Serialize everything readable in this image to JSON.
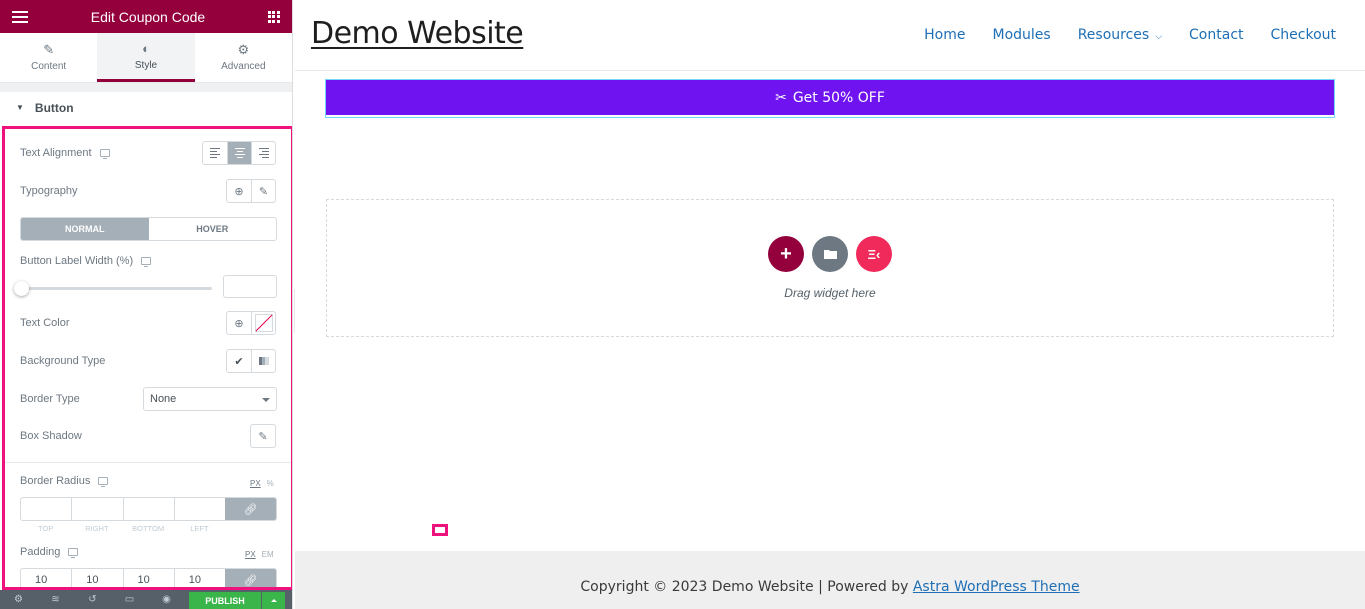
{
  "editor": {
    "title": "Edit Coupon Code",
    "menu_icon": "hamburger-icon",
    "apps_icon": "grid-icon",
    "tabs": [
      {
        "label": "Content",
        "icon": "pencil-icon",
        "active": false
      },
      {
        "label": "Style",
        "icon": "contrast-icon",
        "active": true
      },
      {
        "label": "Advanced",
        "icon": "gear-icon",
        "active": false
      }
    ],
    "section": "Button",
    "controls": {
      "text_alignment": {
        "label": "Text Alignment",
        "options": [
          "left",
          "center",
          "right"
        ],
        "selected": "center"
      },
      "typography": {
        "label": "Typography"
      },
      "state_tabs": {
        "normal": "NORMAL",
        "hover": "HOVER",
        "selected": "NORMAL"
      },
      "label_width": {
        "label": "Button Label Width (%)",
        "value": ""
      },
      "text_color": {
        "label": "Text Color"
      },
      "background_type": {
        "label": "Background Type"
      },
      "border_type": {
        "label": "Border Type",
        "value": "None"
      },
      "box_shadow": {
        "label": "Box Shadow"
      },
      "border_radius": {
        "label": "Border Radius",
        "units": [
          "PX",
          "%"
        ],
        "unit_selected": "PX",
        "values": [
          "",
          "",
          "",
          ""
        ],
        "sides": [
          "TOP",
          "RIGHT",
          "BOTTOM",
          "LEFT"
        ]
      },
      "padding": {
        "label": "Padding",
        "units": [
          "PX",
          "EM"
        ],
        "unit_selected": "PX",
        "values": [
          "10",
          "10",
          "10",
          "10"
        ]
      }
    },
    "footer": {
      "icons": [
        "settings-icon",
        "layers-icon",
        "history-icon",
        "responsive-icon",
        "preview-icon"
      ],
      "publish": "PUBLISH"
    }
  },
  "site": {
    "logo": "Demo Website",
    "nav": [
      "Home",
      "Modules",
      "Resources",
      "Contact",
      "Checkout"
    ],
    "coupon_button": "Get 50% OFF",
    "drop_text": "Drag widget here",
    "footer": {
      "text": "Copyright © 2023 Demo Website | Powered by ",
      "link": "Astra WordPress Theme"
    }
  },
  "colors": {
    "editor_brand": "#93003c",
    "highlight": "#f0127c",
    "coupon_bg": "#6f13f0",
    "publish": "#39b54a",
    "nav_link": "#1e6fb5"
  }
}
